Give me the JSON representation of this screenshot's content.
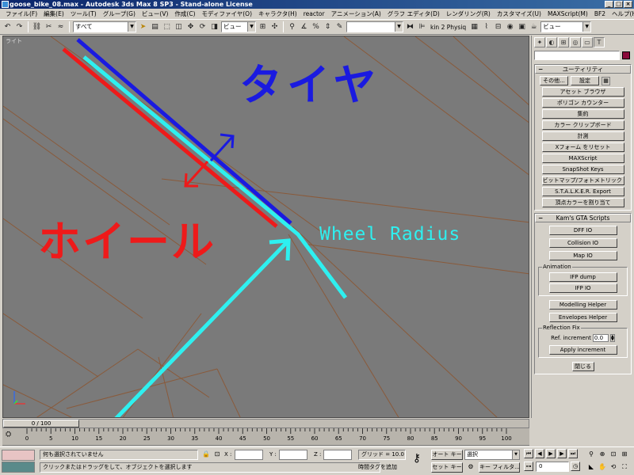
{
  "window": {
    "title": "goose_bike_08.max - Autodesk 3ds Max 8 SP3   - Stand-alone License",
    "controls": [
      "_",
      "□",
      "×"
    ]
  },
  "menu": [
    "ファイル(F)",
    "編集(E)",
    "ツール(T)",
    "グループ(G)",
    "ビュー(V)",
    "作成(C)",
    "モディファイヤ(O)",
    "キャラクタ(H)",
    "reactor",
    "アニメーション(A)",
    "グラフ エディタ(D)",
    "レンダリング(R)",
    "カスタマイズ(U)",
    "MAXScript(M)",
    "BF2",
    "ヘルプ(H)"
  ],
  "toolbar": {
    "selection_filter": "すべて",
    "reference_coord": "ビュー",
    "named_selection": "",
    "render_preset_label": "kin 2 Physiq",
    "viewport_select": "ビュー"
  },
  "viewport": {
    "name": "ライト",
    "tire_label": "タイヤ",
    "wheel_label": "ホイール",
    "radius_label": "Wheel Radius"
  },
  "colors": {
    "tire": "#1a1ae0",
    "wheel": "#ee1a1a",
    "radius": "#2ef0f0",
    "viewport_bg": "#7a7a7a",
    "object_color": "#8b0a3a"
  },
  "command_panel": {
    "tabs": [
      "create-icon",
      "modify-icon",
      "hierarchy-icon",
      "motion-icon",
      "display-icon",
      "utilities-icon"
    ],
    "utilities": {
      "title": "ユーティリティ",
      "more_button": "その他...",
      "sets_button": "設定",
      "items": [
        "アセット ブラウザ",
        "ポリゴン カウンター",
        "集約",
        "カラー クリップボード",
        "計測",
        "Xフォーム をリセット",
        "MAXScript",
        "SnapShot Keys",
        "ビットマップ/フォトメトリック パス",
        "S.T.A.L.K.E.R. Export",
        "頂点カラーを割り当て"
      ]
    },
    "kams": {
      "title": "Kam's GTA Scripts",
      "buttons": [
        "DFF IO",
        "Collision IO",
        "Map IO"
      ],
      "animation": {
        "title": "Animation",
        "buttons": [
          "IFP dump",
          "IFP IO"
        ]
      },
      "helpers": [
        "Modelling Helper",
        "Envelopes Helper"
      ],
      "reflection": {
        "title": "Reflection Fix",
        "increment_label": "Ref. increment",
        "increment_value": "0.0",
        "apply_button": "Apply increment"
      },
      "close_button": "閉じる"
    }
  },
  "timeline": {
    "frame_display": "0 / 100",
    "ticks": [
      "0",
      "5",
      "10",
      "15",
      "20",
      "25",
      "30",
      "35",
      "40",
      "45",
      "50",
      "55",
      "60",
      "65",
      "70",
      "75",
      "80",
      "85",
      "90",
      "95",
      "100"
    ]
  },
  "status": {
    "selection": "何も選択されていません",
    "prompt": "クリックまたはドラッグをして、オブジェクトを選択します",
    "x_label": "X :",
    "y_label": "Y :",
    "z_label": "Z :",
    "grid": "グリッド = 10.0",
    "add_time_tag": "時間タグを追加",
    "auto_key": "オート キー",
    "set_key": "セット キー",
    "key_mode_select": "選択",
    "key_filters": "キー フィルタ...",
    "current_frame": "0"
  }
}
